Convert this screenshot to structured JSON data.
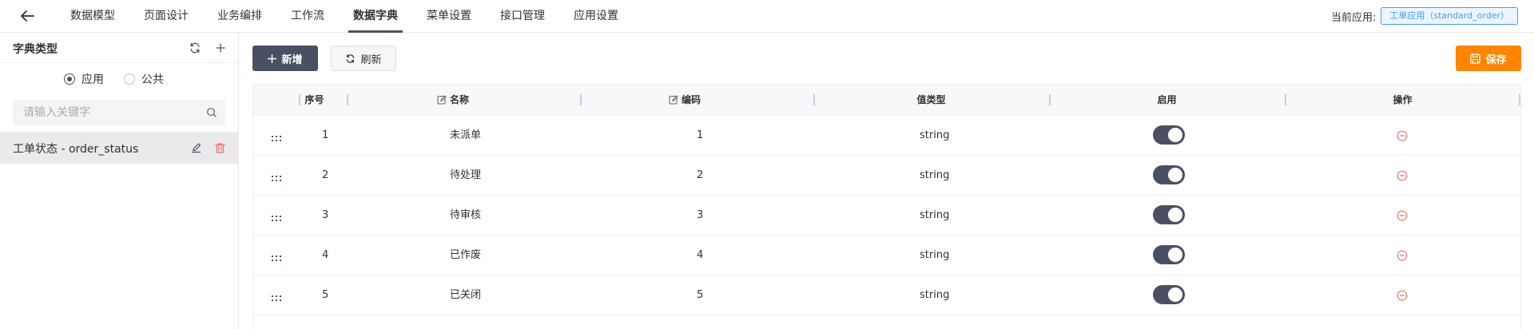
{
  "nav": {
    "back_icon": "arrow-left-icon",
    "items": [
      {
        "label": "数据模型",
        "active": false
      },
      {
        "label": "页面设计",
        "active": false
      },
      {
        "label": "业务编排",
        "active": false
      },
      {
        "label": "工作流",
        "active": false
      },
      {
        "label": "数据字典",
        "active": true
      },
      {
        "label": "菜单设置",
        "active": false
      },
      {
        "label": "接口管理",
        "active": false
      },
      {
        "label": "应用设置",
        "active": false
      }
    ],
    "current_app_label": "当前应用:",
    "current_app_value": "工单应用（standard_order）"
  },
  "sidebar": {
    "title": "字典类型",
    "radios": [
      {
        "label": "应用",
        "checked": true
      },
      {
        "label": "公共",
        "checked": false
      }
    ],
    "search_placeholder": "请输入关键字",
    "items": [
      {
        "label": "工单状态 - order_status",
        "selected": true
      }
    ]
  },
  "toolbar": {
    "add_label": "新增",
    "refresh_label": "刷新",
    "save_label": "保存"
  },
  "table": {
    "columns": [
      "序号",
      "名称",
      "编码",
      "值类型",
      "启用",
      "操作"
    ],
    "rows": [
      {
        "index": "1",
        "name": "未派单",
        "code": "1",
        "type": "string",
        "enabled": true
      },
      {
        "index": "2",
        "name": "待处理",
        "code": "2",
        "type": "string",
        "enabled": true
      },
      {
        "index": "3",
        "name": "待审核",
        "code": "3",
        "type": "string",
        "enabled": true
      },
      {
        "index": "4",
        "name": "已作废",
        "code": "4",
        "type": "string",
        "enabled": true
      },
      {
        "index": "5",
        "name": "已关闭",
        "code": "5",
        "type": "string",
        "enabled": true
      }
    ]
  },
  "colors": {
    "primary": "#4a5063",
    "accent_orange": "#ff8400",
    "danger": "#f56c6c",
    "link_blue": "#409eff"
  }
}
